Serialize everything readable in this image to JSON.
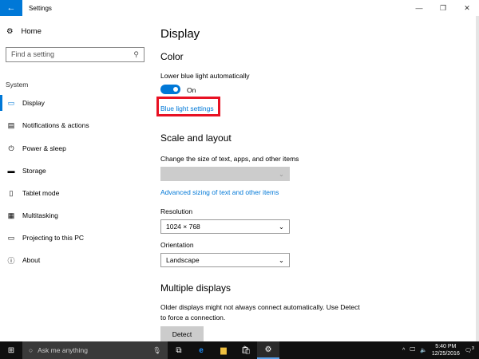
{
  "window": {
    "title": "Settings",
    "back": "←",
    "minimize": "—",
    "maximize": "❐",
    "close": "✕"
  },
  "sidebar": {
    "home": "Home",
    "search_placeholder": "Find a setting",
    "section": "System",
    "items": [
      {
        "label": "Display",
        "icon": "▭"
      },
      {
        "label": "Notifications & actions",
        "icon": "▤"
      },
      {
        "label": "Power & sleep",
        "icon": "⏻"
      },
      {
        "label": "Storage",
        "icon": "▬"
      },
      {
        "label": "Tablet mode",
        "icon": "▯"
      },
      {
        "label": "Multitasking",
        "icon": "▦"
      },
      {
        "label": "Projecting to this PC",
        "icon": "▭"
      },
      {
        "label": "About",
        "icon": "ⓘ"
      }
    ]
  },
  "main": {
    "title": "Display",
    "color_heading": "Color",
    "blue_light_label": "Lower blue light automatically",
    "toggle_state": "On",
    "blue_light_link": "Blue light settings",
    "scale_heading": "Scale and layout",
    "scale_label": "Change the size of text, apps, and other items",
    "scale_value": "",
    "advanced_link": "Advanced sizing of text and other items",
    "resolution_label": "Resolution",
    "resolution_value": "1024 × 768",
    "orientation_label": "Orientation",
    "orientation_value": "Landscape",
    "multi_heading": "Multiple displays",
    "multi_text_1": "Older displays might not always connect automatically. Use Detect",
    "multi_text_2": "to force a connection.",
    "detect": "Detect"
  },
  "taskbar": {
    "search": "Ask me anything",
    "time": "5:40 PM",
    "date": "12/25/2016",
    "notifications": "3"
  }
}
